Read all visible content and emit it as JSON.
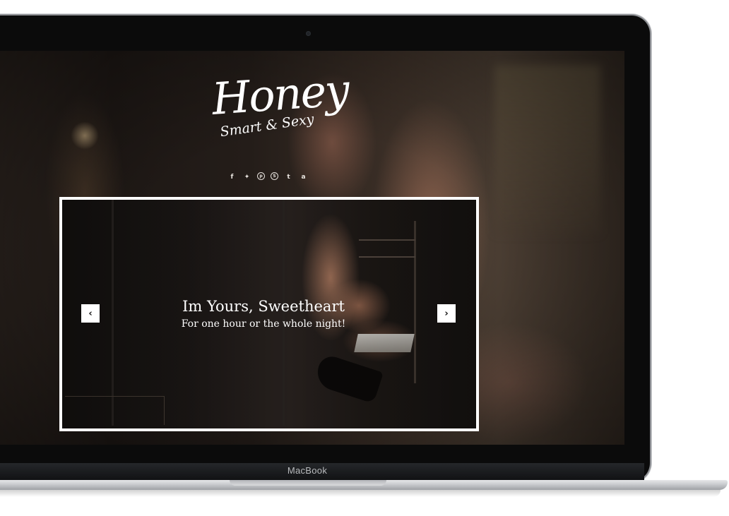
{
  "device": {
    "brand_label": "MacBook"
  },
  "site": {
    "logo": {
      "name": "Honey",
      "tagline": "Smart & Sexy"
    },
    "social_icons": [
      {
        "icon": "facebook-icon",
        "glyph": "f"
      },
      {
        "icon": "twitter-icon",
        "glyph": "✦"
      },
      {
        "icon": "pinterest-icon",
        "glyph": "p"
      },
      {
        "icon": "skype-icon",
        "glyph": "S"
      },
      {
        "icon": "tumblr-icon",
        "glyph": "t"
      },
      {
        "icon": "amazon-icon",
        "glyph": "a"
      }
    ],
    "slider": {
      "title": "Im Yours, Sweetheart",
      "subtitle": "For one hour or the whole night!",
      "prev_glyph": "‹",
      "next_glyph": "›"
    }
  },
  "colors": {
    "text": "#ffffff",
    "frame": "#0b0b0b",
    "slider_border": "#ffffff"
  }
}
